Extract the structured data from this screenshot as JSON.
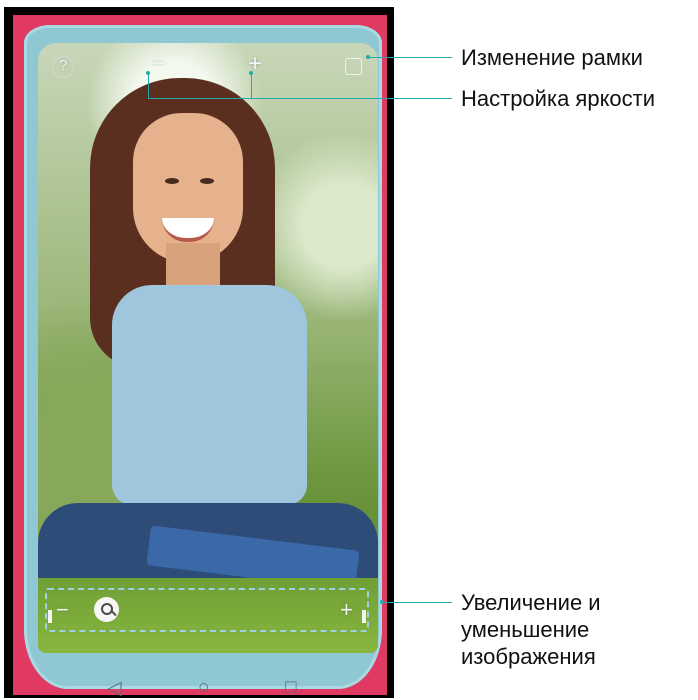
{
  "labels": {
    "frame": "Изменение рамки",
    "brightness": "Настройка яркости",
    "zoom": "Увеличение и уменьшение изображения"
  },
  "controls": {
    "help": "?",
    "minus": "−",
    "plus": "+",
    "zoom_minus": "−",
    "zoom_plus": "+",
    "back": "◁",
    "home": "○",
    "recent": "□"
  },
  "colors": {
    "callout": "#24a9ab",
    "frame": "#e03a62",
    "mirror_border": "#8fc7d3"
  },
  "icons": [
    "help-icon",
    "brightness-down-icon",
    "brightness-up-icon",
    "frame-toggle-icon",
    "zoom-out-icon",
    "zoom-in-icon",
    "search-icon",
    "back-icon",
    "home-icon",
    "recent-apps-icon"
  ]
}
